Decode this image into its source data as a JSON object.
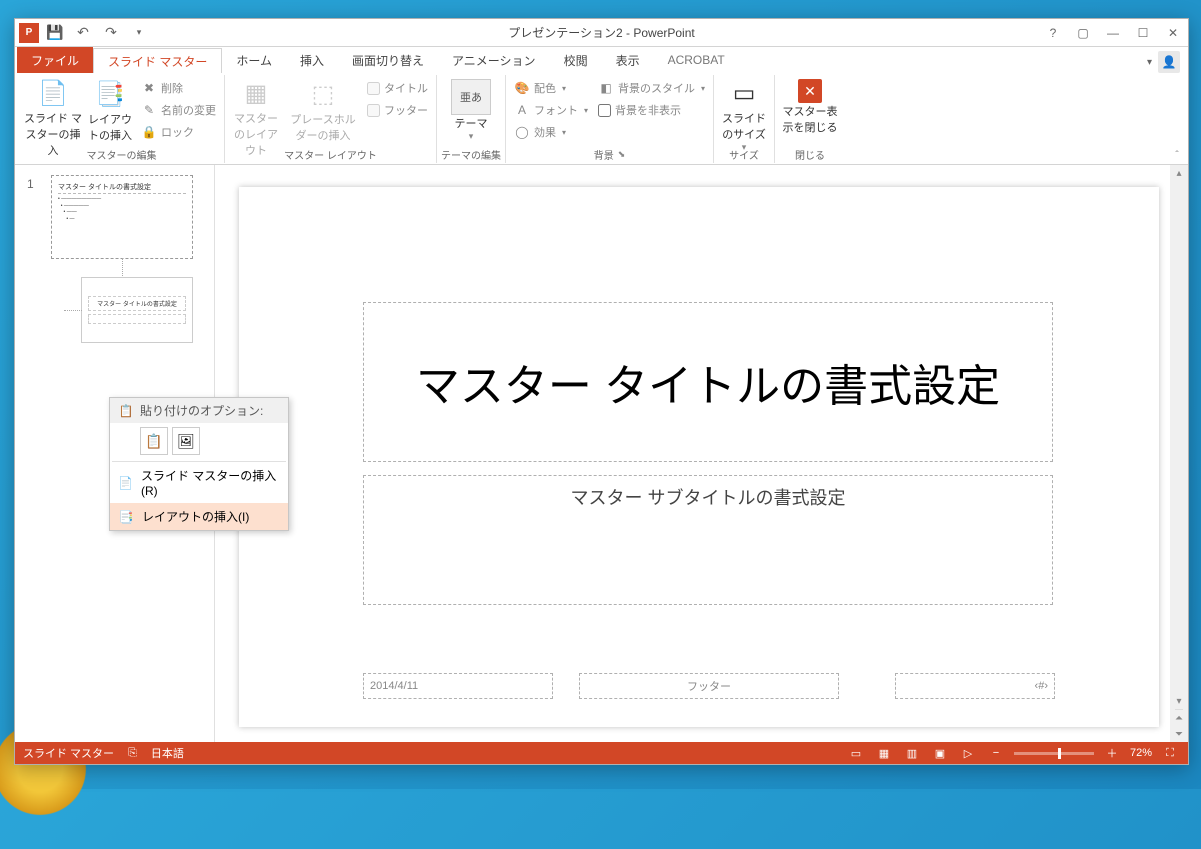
{
  "title": "プレゼンテーション2 - PowerPoint",
  "tabs": {
    "file": "ファイル",
    "slidemaster": "スライド マスター",
    "home": "ホーム",
    "insert": "挿入",
    "transition": "画面切り替え",
    "animation": "アニメーション",
    "review": "校閲",
    "view": "表示",
    "acrobat": "ACROBAT"
  },
  "ribbon": {
    "group_edit_master": "マスターの編集",
    "insert_slide_master": "スライド マスターの挿入",
    "insert_layout": "レイアウトの挿入",
    "delete": "削除",
    "rename": "名前の変更",
    "lock": "ロック",
    "group_master_layout": "マスター レイアウト",
    "master_layout": "マスターのレイアウト",
    "insert_placeholder": "プレースホルダーの挿入",
    "chk_title": "タイトル",
    "chk_footer": "フッター",
    "group_edit_theme": "テーマの編集",
    "theme": "テーマ",
    "theme_glyph": "亜あ",
    "group_background": "背景",
    "colors": "配色",
    "fonts": "フォント",
    "effects": "効果",
    "bg_styles": "背景のスタイル",
    "hide_bg": "背景を非表示",
    "group_size": "サイズ",
    "slide_size": "スライドのサイズ",
    "group_close": "閉じる",
    "close_master": "マスター表示を閉じる"
  },
  "thumb": {
    "number": "1",
    "master_title": "マスター タイトルの書式設定",
    "layout_title": "マスター タイトルの書式設定"
  },
  "context_menu": {
    "paste_header": "貼り付けのオプション:",
    "insert_master": "スライド マスターの挿入(R)",
    "insert_layout": "レイアウトの挿入(I)"
  },
  "slide": {
    "title": "マスター タイトルの書式設定",
    "subtitle": "マスター サブタイトルの書式設定",
    "date": "2014/4/11",
    "footer": "フッター",
    "number": "‹#›"
  },
  "status": {
    "mode": "スライド マスター",
    "language": "日本語",
    "zoom": "72%"
  }
}
